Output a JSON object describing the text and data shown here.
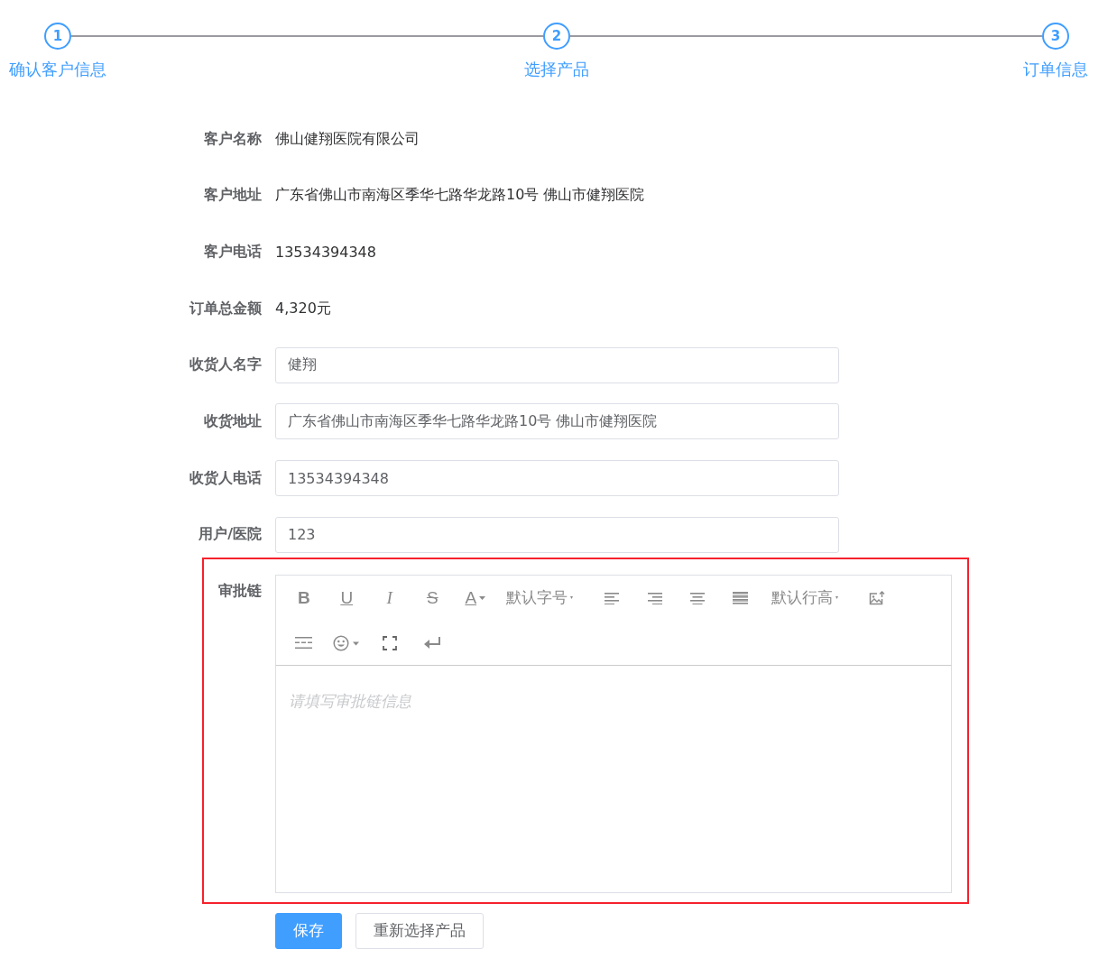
{
  "steps": [
    {
      "number": "1",
      "label": "确认客户信息",
      "active": true
    },
    {
      "number": "2",
      "label": "选择产品",
      "active": true
    },
    {
      "number": "3",
      "label": "订单信息",
      "active": true
    }
  ],
  "form": {
    "rows": [
      {
        "kind": "text",
        "label": "客户名称",
        "value": "佛山健翔医院有限公司"
      },
      {
        "kind": "text",
        "label": "客户地址",
        "value": "广东省佛山市南海区季华七路华龙路10号 佛山市健翔医院"
      },
      {
        "kind": "text",
        "label": "客户电话",
        "value": "13534394348"
      },
      {
        "kind": "text",
        "label": "订单总金额",
        "value": "4,320元"
      },
      {
        "kind": "input",
        "label": "收货人名字",
        "value": "健翔"
      },
      {
        "kind": "input",
        "label": "收货地址",
        "value": "广东省佛山市南海区季华七路华龙路10号 佛山市健翔医院"
      },
      {
        "kind": "input",
        "label": "收货人电话",
        "value": "13534394348"
      },
      {
        "kind": "input",
        "label": "用户/医院",
        "value": "123"
      }
    ],
    "editor": {
      "label": "审批链",
      "highlighted": true,
      "placeholder": "请填写审批链信息",
      "toolbar": [
        {
          "kind": "bold",
          "text": "B"
        },
        {
          "kind": "underline",
          "text": "U"
        },
        {
          "kind": "italic",
          "text": "I"
        },
        {
          "kind": "strike",
          "text": "S"
        },
        {
          "kind": "fontcolor",
          "text": "A"
        },
        {
          "kind": "select",
          "text": "默认字号"
        },
        {
          "kind": "alignleft"
        },
        {
          "kind": "alignright"
        },
        {
          "kind": "aligncenter"
        },
        {
          "kind": "justify"
        },
        {
          "kind": "select",
          "text": "默认行高"
        },
        {
          "kind": "image"
        },
        {
          "kind": "divider"
        },
        {
          "kind": "emoji"
        },
        {
          "kind": "fullscreen"
        },
        {
          "kind": "enter"
        }
      ]
    },
    "buttons": [
      {
        "label": "保存",
        "primary": true
      },
      {
        "label": "重新选择产品",
        "primary": false
      }
    ]
  }
}
